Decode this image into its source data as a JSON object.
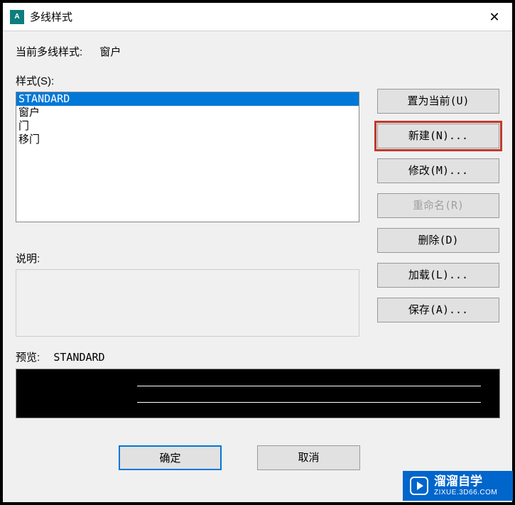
{
  "window": {
    "title": "多线样式"
  },
  "current": {
    "label": "当前多线样式:",
    "value": "窗户"
  },
  "styles": {
    "label": "样式(S):",
    "items": [
      {
        "name": "STANDARD",
        "selected": true
      },
      {
        "name": "窗户",
        "selected": false
      },
      {
        "name": "门",
        "selected": false
      },
      {
        "name": "移门",
        "selected": false
      }
    ]
  },
  "buttons": {
    "set_current": "置为当前(U)",
    "new": "新建(N)...",
    "modify": "修改(M)...",
    "rename": "重命名(R)",
    "delete": "删除(D)",
    "load": "加载(L)...",
    "save": "保存(A)..."
  },
  "desc": {
    "label": "说明:"
  },
  "preview": {
    "label": "预览:",
    "name": "STANDARD"
  },
  "footer": {
    "ok": "确定",
    "cancel": "取消"
  },
  "watermark": {
    "brand": "溜溜自学",
    "sub": "ZIXUE.3D66.COM"
  }
}
